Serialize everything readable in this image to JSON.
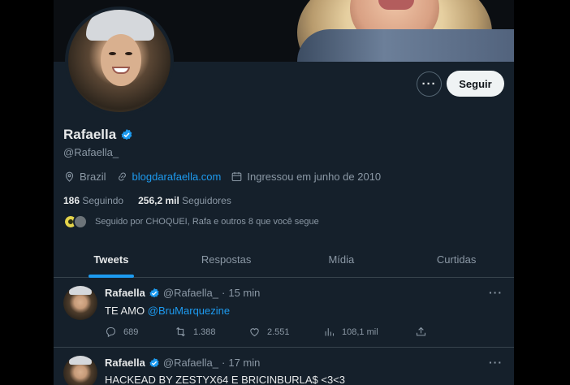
{
  "profile": {
    "name": "Rafaella",
    "handle": "@Rafaella_",
    "location": "Brazil",
    "website": "blogdarafaella.com",
    "joined": "Ingressou em junho de 2010",
    "following_count": "186",
    "following_label": "Seguindo",
    "followers_count": "256,2 mil",
    "followers_label": "Seguidores",
    "followed_by": "Seguido por CHOQUEI, Rafa e outros 8 que você segue"
  },
  "buttons": {
    "more_label": "···",
    "follow_label": "Seguir"
  },
  "tabs": [
    {
      "label": "Tweets",
      "active": true
    },
    {
      "label": "Respostas",
      "active": false
    },
    {
      "label": "Mídia",
      "active": false
    },
    {
      "label": "Curtidas",
      "active": false
    }
  ],
  "tweets": [
    {
      "name": "Rafaella",
      "handle": "@Rafaella_",
      "sep": "·",
      "time": "15 min",
      "text": "TE AMO",
      "mention": "@BruMarquezine",
      "replies": "689",
      "retweets": "1.388",
      "likes": "2.551",
      "views": "108,1 mil",
      "more": "···"
    },
    {
      "name": "Rafaella",
      "handle": "@Rafaella_",
      "sep": "·",
      "time": "17 min",
      "text": "HACKEAD BY ZESTYX64 E BRICINBURLA$ <3<3",
      "more": "···"
    }
  ],
  "colors": {
    "background": "#15202b",
    "accent": "#1d9bf0",
    "muted_text": "#8b98a5",
    "divider": "#38444d"
  }
}
